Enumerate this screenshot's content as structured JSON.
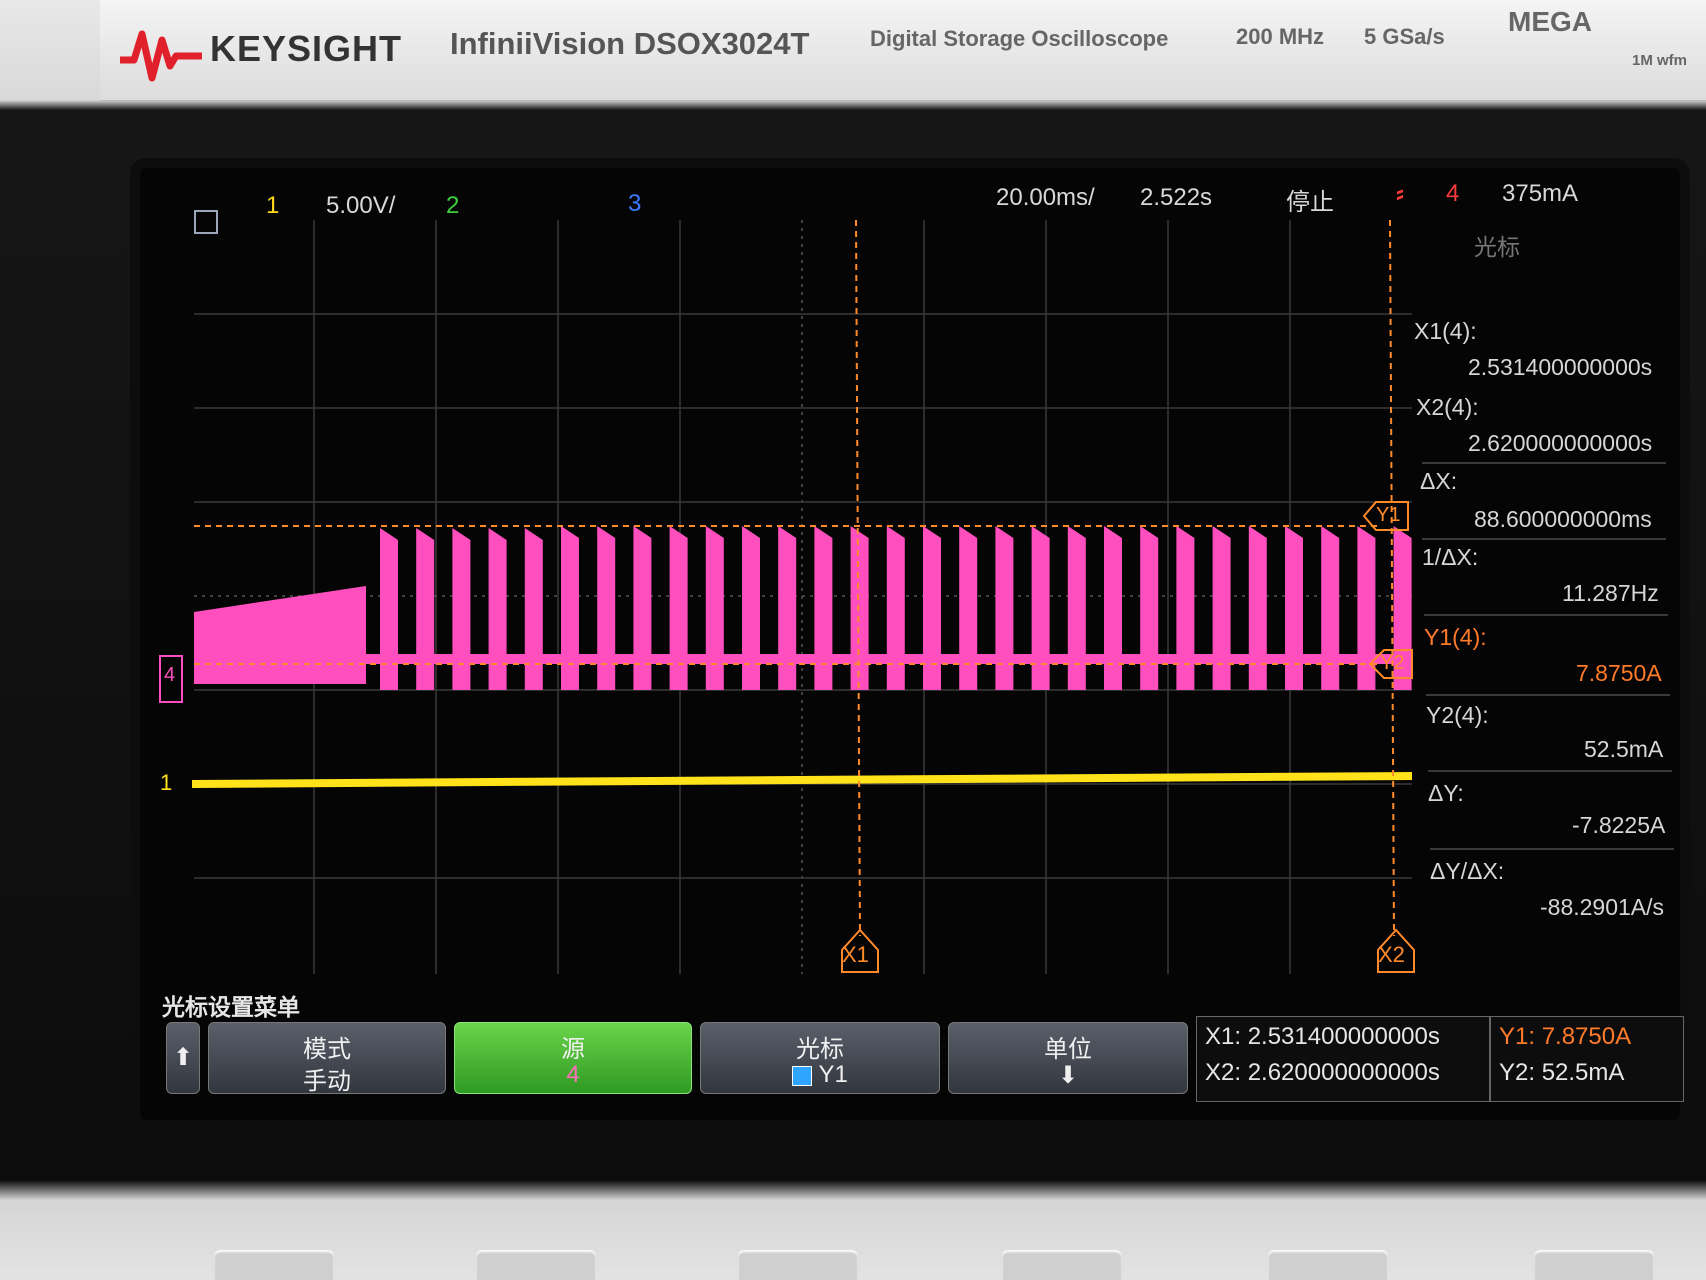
{
  "header": {
    "brand": "KEYSIGHT",
    "model": "InfiniiVision DSOX3024T",
    "description": "Digital Storage Oscilloscope",
    "bandwidth": "200 MHz",
    "sample_rate": "5 GSa/s",
    "megazoom": "MEGA",
    "megazoom_sub": "1M wfm"
  },
  "status_bar": {
    "ch1_label": "1",
    "ch1_scale": "5.00V/",
    "ch2_label": "2",
    "ch3_label": "3",
    "timebase": "20.00ms/",
    "delay": "2.522s",
    "run_state": "停止",
    "trigger_source": "4",
    "trigger_level": "375mA"
  },
  "markers": {
    "x1": "X1",
    "x2": "X2",
    "y1": "Y1",
    "y2": "Y2",
    "ch1": "1",
    "ch4": "4"
  },
  "cursor_panel": {
    "title": "光标",
    "x1_label": "X1(4):",
    "x1_value": "2.531400000000s",
    "x2_label": "X2(4):",
    "x2_value": "2.620000000000s",
    "dx_label": "ΔX:",
    "dx_value": "88.600000000ms",
    "inv_dx_label": "1/ΔX:",
    "inv_dx_value": "11.287Hz",
    "y1_label": "Y1(4):",
    "y1_value": "7.8750A",
    "y2_label": "Y2(4):",
    "y2_value": "52.5mA",
    "dy_label": "ΔY:",
    "dy_value": "-7.8225A",
    "dydx_label": "ΔY/ΔX:",
    "dydx_value": "-88.2901A/s"
  },
  "softkeys": {
    "menu_title": "光标设置菜单",
    "mode_label": "模式",
    "mode_value": "手动",
    "source_label": "源",
    "source_value": "4",
    "cursor_label": "光标",
    "cursor_value": "Y1",
    "units_label": "单位"
  },
  "readout": {
    "x1": "X1:  2.531400000000s",
    "x2": "X2:  2.620000000000s",
    "y1": "Y1: 7.8750A",
    "y2": "Y2: 52.5mA"
  },
  "colors": {
    "ch1": "#ffd91a",
    "ch2": "#3cd13c",
    "ch3": "#3a7bff",
    "ch4": "#ff3ea5",
    "cursor": "#ff8a2a"
  }
}
